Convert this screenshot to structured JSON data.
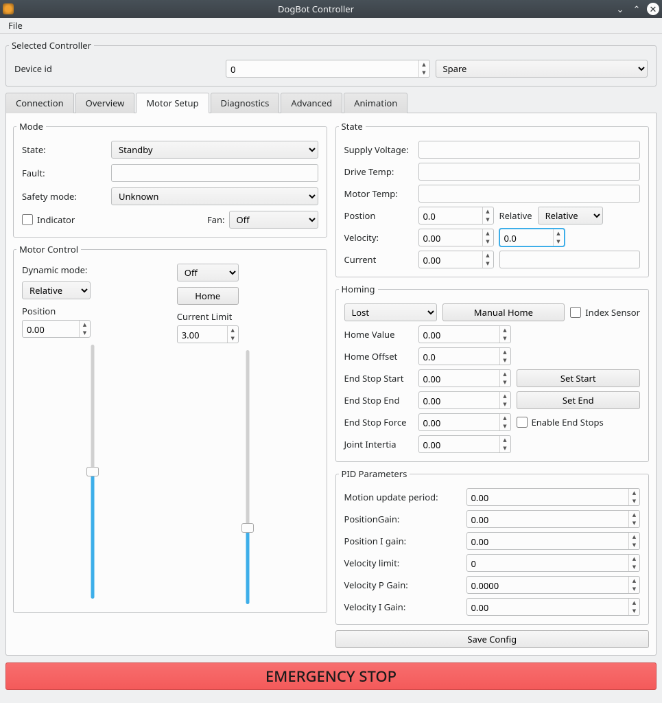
{
  "window": {
    "title": "DogBot Controller"
  },
  "menubar": {
    "file": "File"
  },
  "selected": {
    "legend": "Selected Controller",
    "device_id_label": "Device id",
    "device_id_value": "0",
    "device_name": "Spare"
  },
  "tabs": {
    "connection": "Connection",
    "overview": "Overview",
    "motor_setup": "Motor Setup",
    "diagnostics": "Diagnostics",
    "advanced": "Advanced",
    "animation": "Animation"
  },
  "mode": {
    "legend": "Mode",
    "state_label": "State:",
    "state_value": "Standby",
    "fault_label": "Fault:",
    "fault_value": "",
    "safety_label": "Safety mode:",
    "safety_value": "Unknown",
    "indicator_label": "Indicator",
    "fan_label": "Fan:",
    "fan_value": "Off"
  },
  "state": {
    "legend": "State",
    "supply_label": "Supply Voltage:",
    "supply_value": "",
    "drive_temp_label": "Drive Temp:",
    "drive_temp_value": "",
    "motor_temp_label": "Motor Temp:",
    "motor_temp_value": "",
    "position_label": "Postion",
    "position_value": "0.0",
    "relative_label": "Relative",
    "relative_value": "Relative",
    "velocity_label": "Velocity:",
    "velocity_spin": "0.00",
    "velocity_text": "0.0",
    "current_label": "Current",
    "current_spin": "0.00",
    "current_text": ""
  },
  "motor_control": {
    "legend": "Motor Control",
    "dynamic_mode_label": "Dynamic mode:",
    "dynamic_mode_value": "Off",
    "relative_value": "Relative",
    "home_btn": "Home",
    "position_label": "Position",
    "position_value": "0.00",
    "current_limit_label": "Current Limit",
    "current_limit_value": "3.00"
  },
  "homing": {
    "legend": "Homing",
    "state_value": "Lost",
    "manual_home_btn": "Manual Home",
    "index_sensor_label": "Index Sensor",
    "home_value_label": "Home Value",
    "home_value": "0.00",
    "home_offset_label": "Home Offset",
    "home_offset": "0.0",
    "end_stop_start_label": "End Stop Start",
    "end_stop_start": "0.00",
    "set_start_btn": "Set Start",
    "end_stop_end_label": "End Stop End",
    "end_stop_end": "0.00",
    "set_end_btn": "Set End",
    "end_stop_force_label": "End Stop Force",
    "end_stop_force": "0.00",
    "enable_end_stops_label": "Enable End Stops",
    "joint_inertia_label": "Joint Intertia",
    "joint_inertia": "0.00"
  },
  "pid": {
    "legend": "PID Parameters",
    "motion_period_label": "Motion update period:",
    "motion_period": "0.00",
    "position_gain_label": "PositionGain:",
    "position_gain": "0.00",
    "position_i_label": "Position I gain:",
    "position_i": "0.00",
    "velocity_limit_label": "Velocity limit:",
    "velocity_limit": "0",
    "velocity_p_label": "Velocity P Gain:",
    "velocity_p": "0.0000",
    "velocity_i_label": "Velocity I Gain:",
    "velocity_i": "0.00"
  },
  "save_config_btn": "Save Config",
  "emergency_btn": "EMERGENCY STOP"
}
